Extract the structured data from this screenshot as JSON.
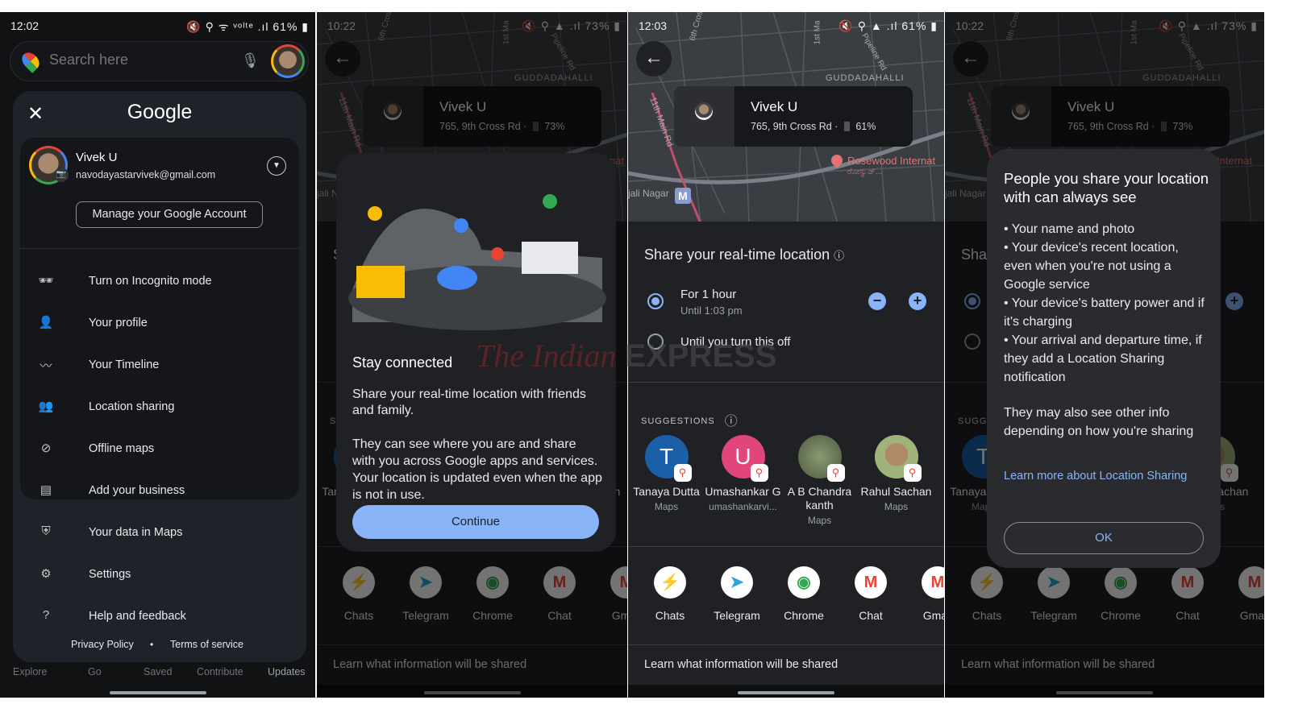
{
  "panel1": {
    "status": {
      "time": "12:02",
      "icons": "🔇 ⚲ ᯤ ᵛᵒˡᵗᵉ .ıl",
      "battery": "61%"
    },
    "search": {
      "placeholder": "Search here"
    },
    "menu": {
      "title": "Google",
      "account": {
        "name": "Vivek U",
        "email": "navodayastarvivek@gmail.com",
        "manage": "Manage your Google Account"
      },
      "items": [
        {
          "icon": "incognito-icon",
          "label": "Turn on Incognito mode"
        },
        {
          "icon": "profile-icon",
          "label": "Your profile"
        },
        {
          "icon": "timeline-icon",
          "label": "Your Timeline"
        },
        {
          "icon": "location-sharing-icon",
          "label": "Location sharing"
        },
        {
          "icon": "offline-maps-icon",
          "label": "Offline maps"
        },
        {
          "icon": "business-icon",
          "label": "Add your business"
        },
        {
          "icon": "shield-icon",
          "label": "Your data in Maps"
        },
        {
          "icon": "gear-icon",
          "label": "Settings"
        },
        {
          "icon": "help-icon",
          "label": "Help and feedback"
        }
      ],
      "privacy": "Privacy Policy",
      "dot": "•",
      "terms": "Terms of service"
    },
    "bottom_nav": [
      "Explore",
      "Go",
      "Saved",
      "Contribute",
      "Updates"
    ]
  },
  "location_card": {
    "name": "Vivek U",
    "address": "765, 9th Cross Rd",
    "battery_a": "73%",
    "battery_b": "61%"
  },
  "map_labels": {
    "area": "GUDDADAHALLI",
    "poi": "Rosewood Internat",
    "poi_kn": "ರೋಸ್ವುಡ್...",
    "road1": "6th Cross Rd",
    "road2": "11th Main Rd",
    "road3": "1st Ma",
    "road4": "Pipeline Rd",
    "area2": "jali Nagar",
    "metro": "M"
  },
  "panel2": {
    "status": {
      "time": "10:22",
      "battery": "73%"
    },
    "dialog": {
      "title": "Stay connected",
      "p1": "Share your real-time location with friends and family.",
      "p2": "They can see where you are and share with you across Google apps and services. Your location is updated even when the app is not in use.",
      "continue": "Continue"
    }
  },
  "panel3": {
    "status": {
      "time": "12:03",
      "battery": "61%"
    },
    "share_title": "Share your real-time location",
    "option1": {
      "label": "For 1 hour",
      "sub": "Until 1:03 pm",
      "selected": true
    },
    "option2": {
      "label": "Until you turn this off",
      "selected": false
    },
    "suggestions_label": "SUGGESTIONS",
    "suggestions": [
      {
        "initial": "T",
        "name": "Tanaya Dutta",
        "sub": "Maps",
        "color": "#1a5fa8"
      },
      {
        "initial": "U",
        "name": "Umashankar G",
        "sub": "umashankarvi...",
        "color": "#e0457b"
      },
      {
        "initial": "",
        "name": "A B Chandra kanth",
        "sub": "Maps"
      },
      {
        "initial": "",
        "name": "Rahul Sachan",
        "sub": "Maps"
      }
    ],
    "apps": [
      {
        "name": "Chats",
        "glyph": "⚡",
        "color": "#a142f4"
      },
      {
        "name": "Telegram",
        "glyph": "➤",
        "color": "#2aa3df"
      },
      {
        "name": "Chrome",
        "glyph": "◉",
        "color": "#34a853"
      },
      {
        "name": "Chat",
        "glyph": "M",
        "color": "#ea4335"
      },
      {
        "name": "Gmail",
        "glyph": "M",
        "color": "#ea4335"
      }
    ],
    "learn": "Learn what information will be shared"
  },
  "panel4": {
    "status": {
      "time": "10:22",
      "battery": "73%"
    },
    "dialog": {
      "title": "People you share your location with can always see",
      "bullets": [
        "• Your name and photo",
        "• Your device's recent location, even when you're not using a Google service",
        "• Your device's battery power and if it's charging",
        "• Your arrival and departure time, if they add a Location Sharing notification"
      ],
      "note": "They may also see other info depending on how you're sharing",
      "link": "Learn more about Location Sharing",
      "ok": "OK"
    }
  },
  "watermark": {
    "a": "The Indian",
    "b": "EXPRESS"
  },
  "colors": {
    "accent": "#8ab4f8",
    "sheet": "#202124",
    "menu": "#1f2229"
  }
}
